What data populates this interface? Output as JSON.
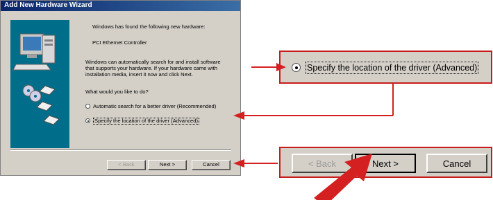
{
  "dialog": {
    "title": "Add New Hardware Wizard",
    "found_text": "Windows has found the following new hardware:",
    "device_name": "PCI Ethernet Controller",
    "info_lines": [
      "Windows can automatically search for and install software",
      "that supports your hardware. If your hardware came with",
      "installation media, insert it now and click Next."
    ],
    "question": "What would you like to do?",
    "options": [
      {
        "label": "Automatic search for a better driver (Recommended)",
        "selected": false
      },
      {
        "label": "Specify the location of the driver (Advanced)",
        "selected": true
      }
    ],
    "buttons": {
      "back": "< Back",
      "next": "Next >",
      "cancel": "Cancel"
    }
  },
  "zoom_option": {
    "label": "Specify the location of the driver (Advanced)",
    "selected": true
  },
  "zoom_buttons": {
    "back": "< Back",
    "next": "Next >",
    "cancel": "Cancel"
  },
  "colors": {
    "accent": "#d42020",
    "dialog_bg": "#d4d0c8",
    "title_bar": "#0a246a",
    "panel": "#006e8a"
  }
}
